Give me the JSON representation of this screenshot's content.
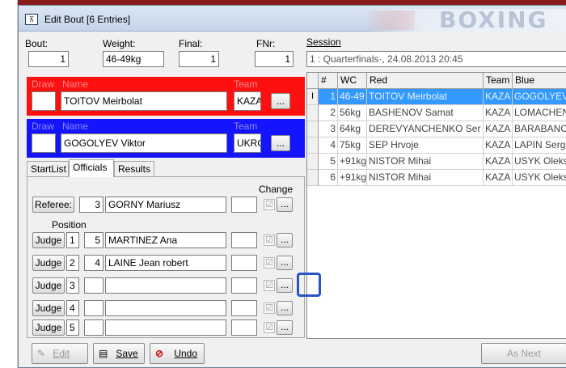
{
  "window": {
    "title": "Edit Bout [6 Entries]",
    "title_icon": "bracket-icon",
    "brand_text": "BOXING"
  },
  "bout_info": {
    "bout_label": "Bout:",
    "bout_value": "1",
    "weight_label": "Weight:",
    "weight_value": "46-49kg",
    "final_label": "Final:",
    "final_value": "1",
    "fnr_label": "FNr:",
    "fnr_value": "1"
  },
  "red": {
    "draw_label": "Draw",
    "name_label": "Name",
    "team_label": "Team",
    "name": "TOITOV Meirbolat",
    "team": "KAZA",
    "button": "...",
    "color": "#ff1010"
  },
  "blue": {
    "draw_label": "Draw",
    "name_label": "Name",
    "team_label": "Team",
    "name": "GOGOLYEV Viktor",
    "team": "UKRO",
    "button": "...",
    "color": "#1414ff"
  },
  "tabs": [
    "StartList",
    "Officials",
    "Results"
  ],
  "officials": {
    "change_label": "Change",
    "position_label": "Position",
    "referee": {
      "label": "Referee:",
      "number": "3",
      "name": "GORNY Mariusz"
    },
    "judges": [
      {
        "label": "Judge",
        "pos": "1",
        "number": "5",
        "name": "MARTINEZ Ana"
      },
      {
        "label": "Judge",
        "pos": "2",
        "number": "4",
        "name": "LAINE Jean robert"
      },
      {
        "label": "Judge",
        "pos": "3",
        "number": "",
        "name": ""
      },
      {
        "label": "Judge",
        "pos": "4",
        "number": "",
        "name": ""
      },
      {
        "label": "Judge",
        "pos": "5",
        "number": "",
        "name": ""
      }
    ],
    "check_glyph": "☑",
    "dots": "..."
  },
  "session": {
    "label": "Session",
    "value": "1 : Quarterfinals·, 24.08.2013 20:45"
  },
  "grid": {
    "columns": [
      "#",
      "WC",
      "Red",
      "Team",
      "Blue"
    ],
    "rows": [
      {
        "num": "1",
        "wc": "46-49",
        "red": "TOITOV Meirbolat",
        "team": "KAZA",
        "blue": "GOGOLYEV"
      },
      {
        "num": "2",
        "wc": "56kg",
        "red": "BASHENOV Samat",
        "team": "KAZA",
        "blue": "LOMACHEN"
      },
      {
        "num": "3",
        "wc": "64kg",
        "red": "DEREVYANCHENKO Ser",
        "team": "KAZA",
        "blue": "BARABANO"
      },
      {
        "num": "4",
        "wc": "75kg",
        "red": "SEP Hrvoje",
        "team": "KAZA",
        "blue": "LAPIN Serg"
      },
      {
        "num": "5",
        "wc": "+91kg",
        "red": "NISTOR Mihai",
        "team": "KAZA",
        "blue": "USYK Oleks"
      },
      {
        "num": "6",
        "wc": "+91kg",
        "red": "NISTOR Mihai",
        "team": "KAZA",
        "blue": "USYK Oleks"
      }
    ],
    "cursor_glyph": "I"
  },
  "buttons": {
    "edit": "Edit",
    "save": "Save",
    "undo": "Undo",
    "as_next": "As Next"
  }
}
